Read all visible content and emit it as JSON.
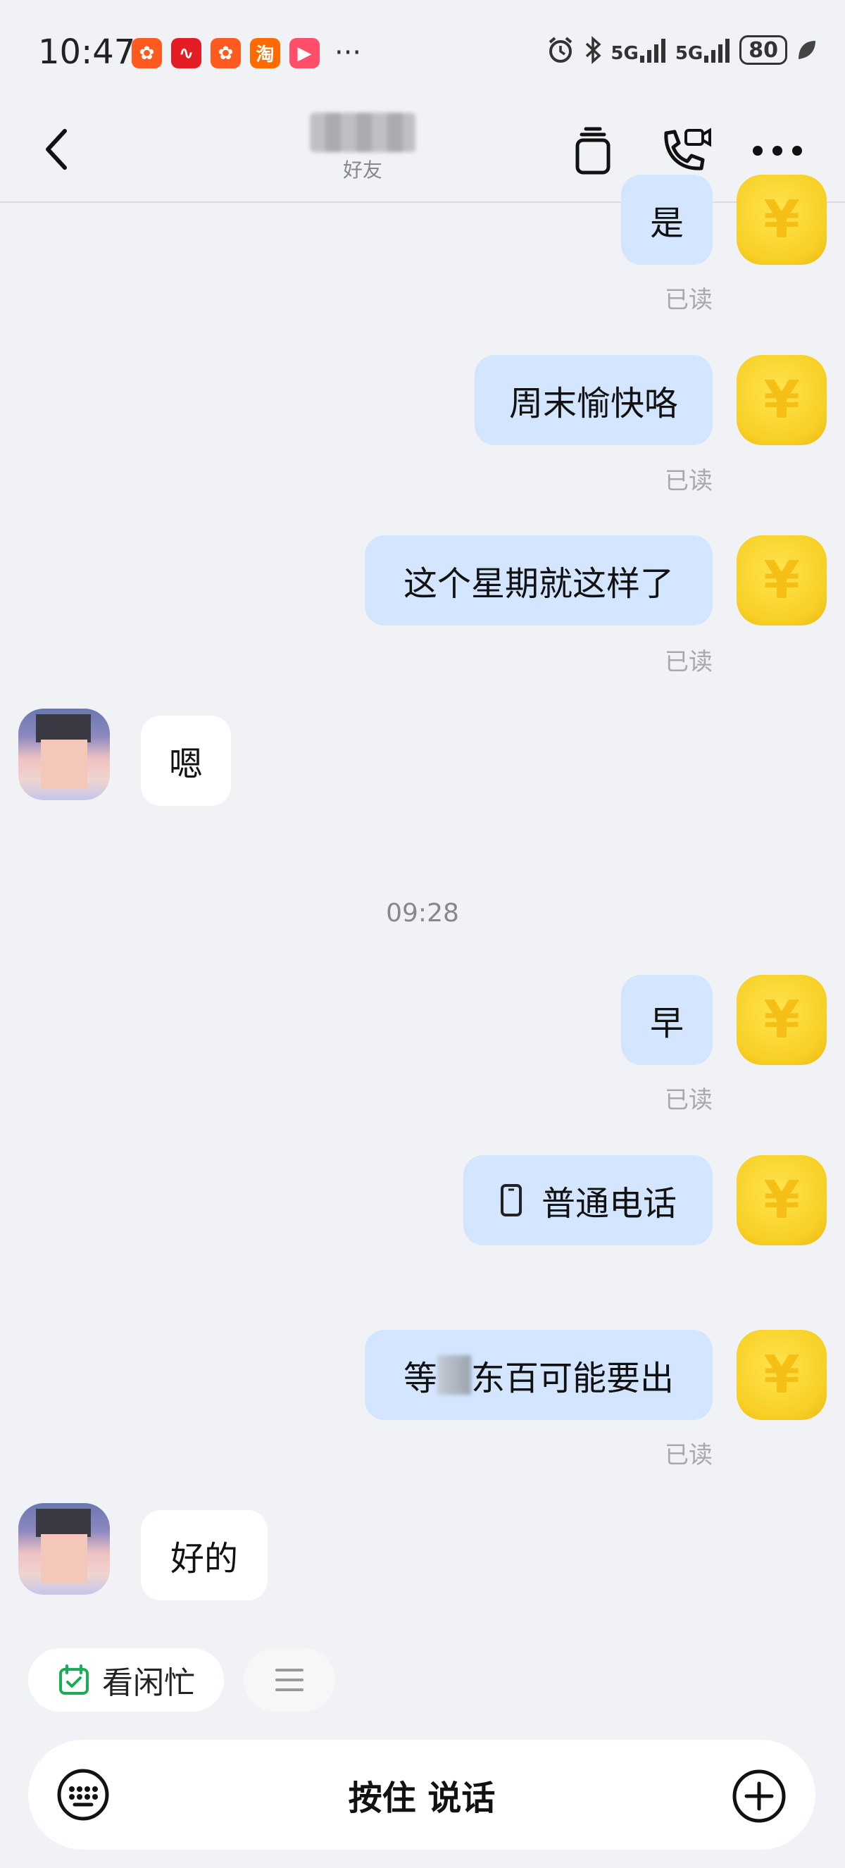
{
  "status_bar": {
    "time": "10:47",
    "dots": "···",
    "battery": "80",
    "signal_1": "5G",
    "signal_2": "5G"
  },
  "nav": {
    "subtitle": "好友"
  },
  "messages": [
    {
      "side": "right",
      "text": "是",
      "read": "已读"
    },
    {
      "side": "right",
      "text": "周末愉快咯",
      "read": "已读"
    },
    {
      "side": "right",
      "text": "这个星期就这样了",
      "read": "已读"
    },
    {
      "side": "left",
      "text": "嗯"
    },
    {
      "type": "time",
      "text": "09:28"
    },
    {
      "side": "right",
      "text": "早",
      "read": "已读"
    },
    {
      "side": "right",
      "text": "普通电话",
      "icon": "phone-icon"
    },
    {
      "side": "right",
      "text_a": "等",
      "text_b": "东百可能要出",
      "read": "已读"
    },
    {
      "side": "left",
      "text": "好的"
    }
  ],
  "avatar_self_glyph": "¥",
  "bottom": {
    "chip_label": "看闲忙",
    "hold_to_talk": "按住 说话"
  },
  "colors": {
    "background": "#f1f2f5",
    "bubble_self": "#d4e6ff",
    "bubble_other": "#ffffff",
    "avatar_gold": "#f7cf24"
  }
}
